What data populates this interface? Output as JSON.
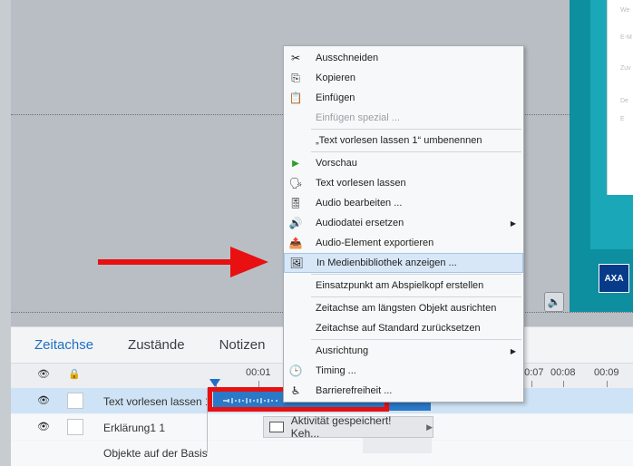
{
  "slide": {
    "card_texts": [
      "We",
      "E-M",
      "Zuv",
      "De",
      "E"
    ],
    "logo_text": "AXA"
  },
  "panel": {
    "tabs": [
      "Zeitachse",
      "Zustände",
      "Notizen"
    ],
    "active_tab": "Zeitachse",
    "ticks": [
      "00:01",
      "00:07",
      "00:08",
      "00:09"
    ],
    "rows": [
      "Text vorlesen lassen 1",
      "Erklärung1 1",
      "Objekte auf der Basis"
    ],
    "activity_label": "Aktivität gespeichert! Keh..."
  },
  "context_menu": {
    "items": [
      {
        "label": "Ausschneiden",
        "icon": "scissors-icon",
        "disabled": false
      },
      {
        "label": "Kopieren",
        "icon": "copy-icon",
        "disabled": false
      },
      {
        "label": "Einfügen",
        "icon": "paste-icon",
        "disabled": false
      },
      {
        "label": "Einfügen spezial ...",
        "icon": "",
        "disabled": true
      },
      {
        "label": "„Text vorlesen lassen 1“ umbenennen",
        "icon": "",
        "disabled": false
      },
      {
        "label": "Vorschau",
        "icon": "play-icon",
        "disabled": false
      },
      {
        "label": "Text vorlesen lassen",
        "icon": "text-to-speech-icon",
        "disabled": false
      },
      {
        "label": "Audio bearbeiten ...",
        "icon": "audio-edit-icon",
        "disabled": false
      },
      {
        "label": "Audiodatei ersetzen",
        "icon": "audio-replace-icon",
        "disabled": false,
        "submenu": true
      },
      {
        "label": "Audio-Element exportieren",
        "icon": "export-icon",
        "disabled": false
      },
      {
        "label": "In Medienbibliothek anzeigen ...",
        "icon": "media-library-icon",
        "disabled": false,
        "highlighted": true
      },
      {
        "label": "Einsatzpunkt am Abspielkopf erstellen",
        "icon": "",
        "disabled": false
      },
      {
        "label": "Zeitachse am längsten Objekt ausrichten",
        "icon": "",
        "disabled": false
      },
      {
        "label": "Zeitachse auf Standard zurücksetzen",
        "icon": "",
        "disabled": false
      },
      {
        "label": "Ausrichtung",
        "icon": "",
        "disabled": false,
        "submenu": true
      },
      {
        "label": "Timing ...",
        "icon": "clock-icon",
        "disabled": false
      },
      {
        "label": "Barrierefreiheit ...",
        "icon": "accessibility-icon",
        "disabled": false
      }
    ]
  },
  "colors": {
    "accent": "#1f6fc4",
    "annotation_red": "#e81010",
    "menu_highlight": "#d7e7f7",
    "slide_teal": "#0e8fa0"
  }
}
